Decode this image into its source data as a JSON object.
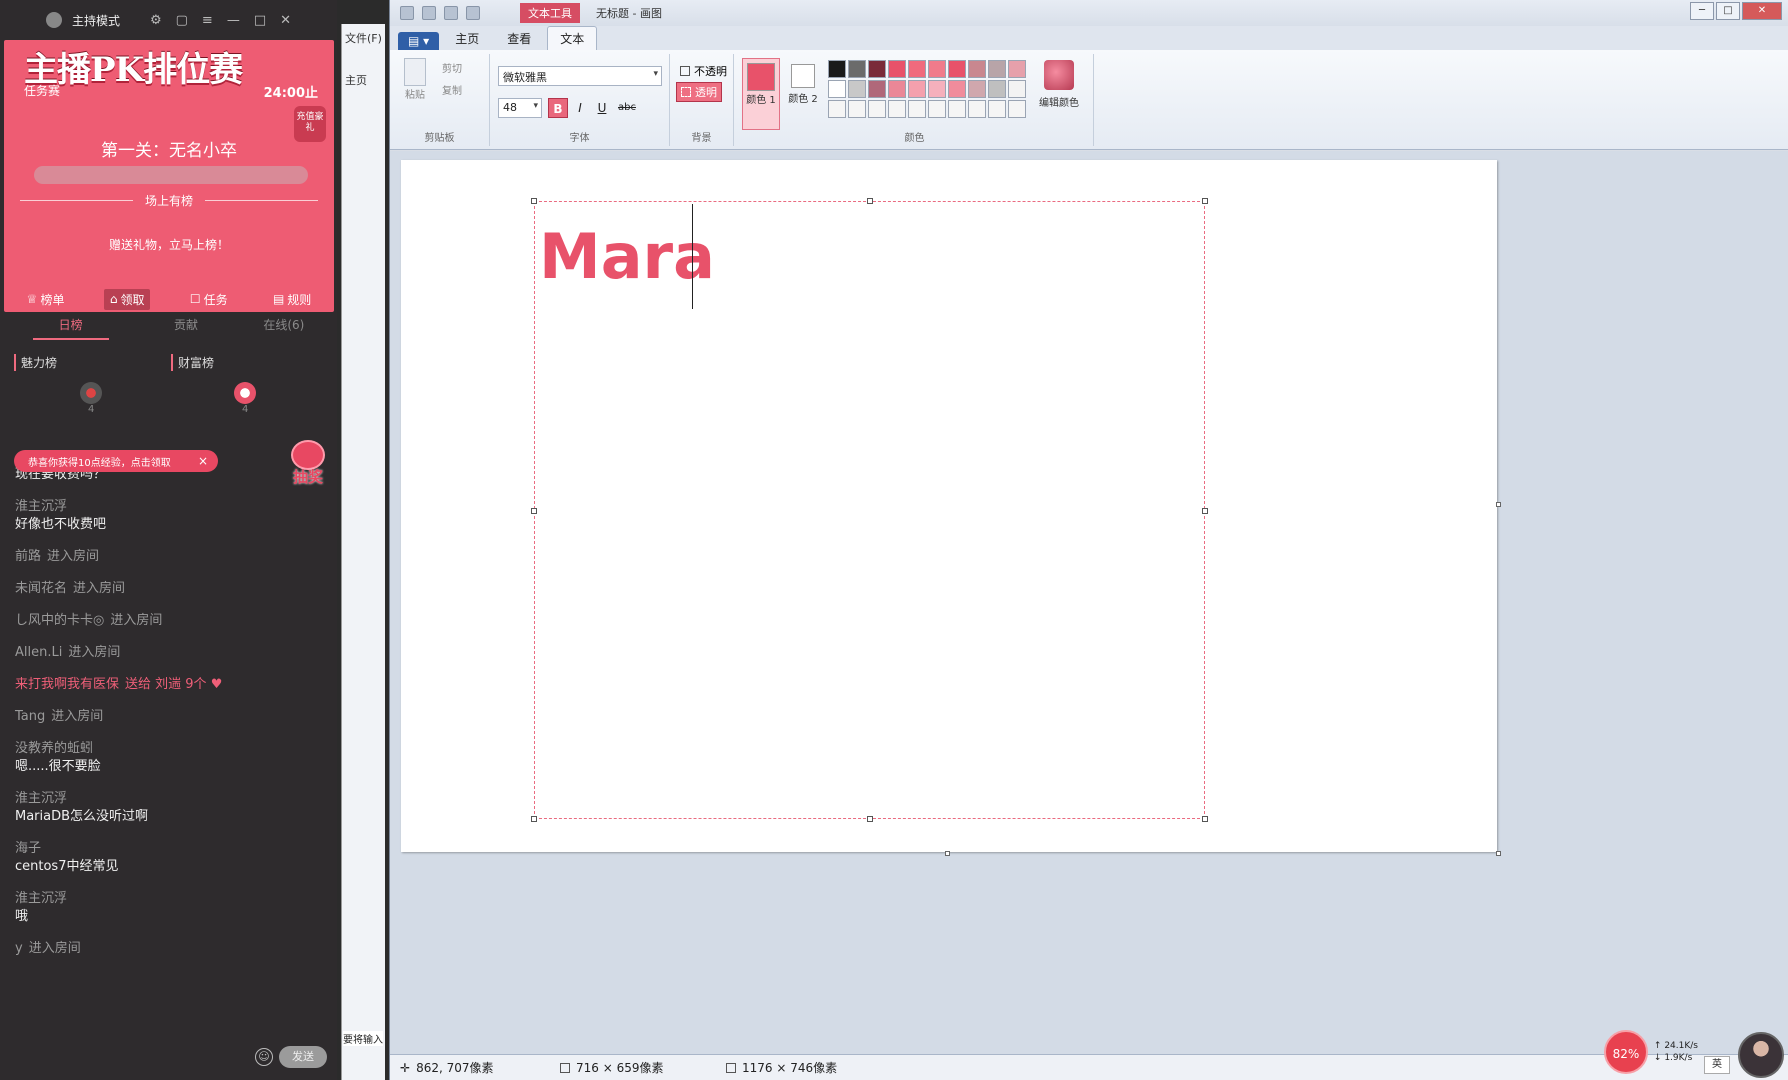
{
  "stream": {
    "mode_label": "主持模式",
    "pk": {
      "banner": "主播PK排位赛",
      "type": "任务赛",
      "deadline": "24:00止",
      "badge": "充值豪礼",
      "level": "第一关：无名小卒",
      "progress": 0,
      "section_title": "场上有榜",
      "hint": "赠送礼物，立马上榜！",
      "tabs": [
        {
          "label": "榜单",
          "active": false
        },
        {
          "label": "领取",
          "active": true
        },
        {
          "label": "任务",
          "active": false
        },
        {
          "label": "规则",
          "active": false
        }
      ]
    },
    "rank_tabs": [
      {
        "label": "日榜",
        "active": true
      },
      {
        "label": "贡献",
        "active": false
      },
      {
        "label": "在线(6)",
        "active": false
      }
    ],
    "boards": [
      "魅力榜",
      "财富榜"
    ],
    "board_counts": [
      "4",
      "4"
    ],
    "toast": "恭喜你获得10点经验，点击领取",
    "toast_close": "×",
    "lottery": "抽奖",
    "chat": [
      {
        "kind": "msg",
        "user": "",
        "text": "现在要收费吗？"
      },
      {
        "kind": "msg",
        "user": "淮主沉浮",
        "text": "好像也不收费吧"
      },
      {
        "kind": "enter",
        "user": "前路",
        "text": "进入房间"
      },
      {
        "kind": "enter",
        "user": "未闻花名",
        "text": "进入房间"
      },
      {
        "kind": "enter",
        "user": "し风中的卡卡◎",
        "text": "进入房间"
      },
      {
        "kind": "enter",
        "user": "Allen.Li",
        "text": "进入房间"
      },
      {
        "kind": "gift",
        "user": "来打我啊我有医保",
        "text": "送给 刘遄 9个"
      },
      {
        "kind": "enter",
        "user": "Tang",
        "text": "进入房间"
      },
      {
        "kind": "msg",
        "user": "没教养的蚯蚓",
        "text": "嗯.....很不要脸"
      },
      {
        "kind": "msg",
        "user": "淮主沉浮",
        "text": "MariaDB怎么没听过啊"
      },
      {
        "kind": "msg",
        "user": "海子",
        "text": "centos7中经常见"
      },
      {
        "kind": "msg",
        "user": "淮主沉浮",
        "text": "哦"
      },
      {
        "kind": "enter",
        "user": "y",
        "text": "进入房间"
      }
    ],
    "send": "发送"
  },
  "strip": {
    "file_tab": "文件(F)",
    "home": "主页",
    "input_hint": "要将输入"
  },
  "paint": {
    "context_tab": "文本工具",
    "doc_title": "无标题 - 画图",
    "tabs": [
      {
        "label": "主页",
        "active": false
      },
      {
        "label": "查看",
        "active": false
      },
      {
        "label": "文本",
        "active": true
      }
    ],
    "clipboard": {
      "paste": "粘贴",
      "cut": "剪切",
      "copy": "复制",
      "label": "剪贴板"
    },
    "font": {
      "family": "微软雅黑",
      "size": "48",
      "bold": "B",
      "italic": "I",
      "underline": "U",
      "strike": "abc",
      "label": "字体"
    },
    "background": {
      "opaque": "不透明",
      "transparent": "透明",
      "label": "背景"
    },
    "colors": {
      "color1": "颜色 1",
      "color2": "颜色 2",
      "edit": "编辑颜色",
      "label": "颜色",
      "color1_value": "#e8526a",
      "palette": [
        "#1a1a1a",
        "#6b6b6b",
        "#7a2b39",
        "#e8526a",
        "#f06a7d",
        "#f07b8b",
        "#e8526a",
        "#c9878f",
        "#b8a4a8",
        "#e6a0ab",
        "#ffffff",
        "#c8c8c8",
        "#b0687a",
        "#ea8797",
        "#f4a0ad",
        "#f5b0bc",
        "#f08c9c",
        "#d0a7ad",
        "#bfbfbf",
        "#f3f3f3",
        "#f5f5f5",
        "#f5f5f5",
        "#f5f5f5",
        "#f5f5f5",
        "#f5f5f5",
        "#f5f5f5",
        "#f5f5f5",
        "#f5f5f5",
        "#f5f5f5",
        "#f5f5f5"
      ]
    },
    "canvas_text": "Mara",
    "status": {
      "cursor": "862, 707像素",
      "selection": "716 × 659像素",
      "canvas_size": "1176 × 746像素"
    }
  },
  "tray": {
    "cpu": "82%",
    "up": "24.1K/s",
    "down": "1.9K/s",
    "ime": "英"
  }
}
